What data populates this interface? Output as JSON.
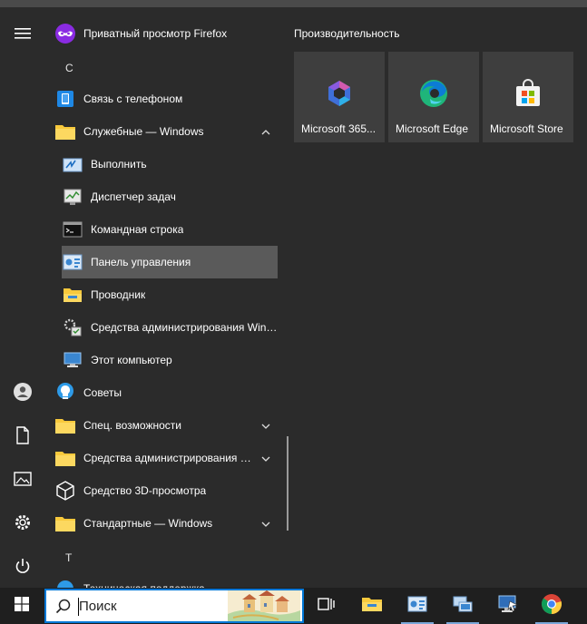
{
  "start": {
    "rail": [
      "menu-icon",
      "user-icon",
      "document-icon",
      "pictures-icon",
      "settings-icon",
      "power-icon"
    ],
    "apps": [
      {
        "label": "Приватный просмотр Firefox"
      },
      {
        "letter": "С"
      },
      {
        "label": "Связь с телефоном"
      },
      {
        "label": "Служебные — Windows"
      },
      {
        "label": "Выполнить"
      },
      {
        "label": "Диспетчер задач"
      },
      {
        "label": "Командная строка"
      },
      {
        "label": "Панель управления"
      },
      {
        "label": "Проводник"
      },
      {
        "label": "Средства администрирования Windows"
      },
      {
        "label": "Этот компьютер"
      },
      {
        "label": "Советы"
      },
      {
        "label": "Спец. возможности"
      },
      {
        "label": "Средства администрирования Windows"
      },
      {
        "label": "Средство 3D-просмотра"
      },
      {
        "label": "Стандартные — Windows"
      },
      {
        "letter": "Т"
      },
      {
        "label": "Техническая поддержка"
      }
    ],
    "tiles_title": "Производительность",
    "tiles": [
      {
        "label": "Microsoft 365..."
      },
      {
        "label": "Microsoft Edge"
      },
      {
        "label": "Microsoft Store"
      }
    ]
  },
  "taskbar": {
    "search_text": "Поиск",
    "icons": [
      "task-view-icon",
      "file-explorer-icon",
      "control-panel-icon",
      "network-icon",
      "remote-desktop-icon",
      "chrome-icon"
    ]
  },
  "colors": {
    "accent": "#0078d7",
    "folder": "#f8c93c",
    "tile": "#3e3e3e",
    "highlight": "#5a5a5a"
  }
}
